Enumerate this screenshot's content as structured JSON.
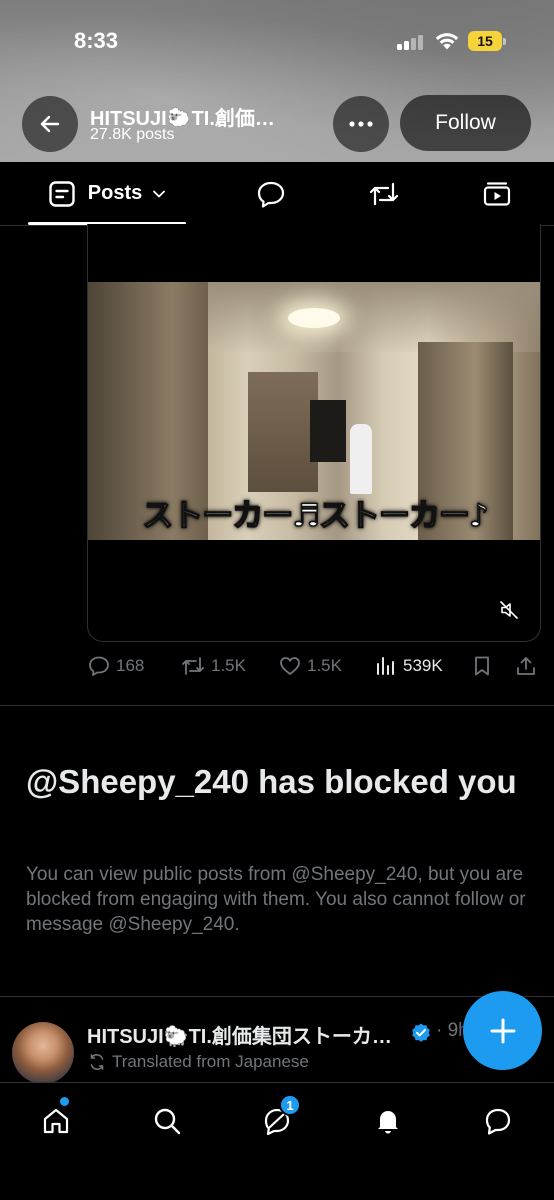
{
  "status_bar": {
    "time": "8:33",
    "battery_level": "15",
    "battery_color": "#f5d33a"
  },
  "header": {
    "profile_name": "HITSUJI🐑TI.創価…",
    "post_count": "27.8K posts",
    "follow_label": "Follow",
    "back_icon": "arrow-left-icon",
    "more_icon": "ellipsis-icon"
  },
  "tabs": {
    "posts_label": "Posts",
    "items": [
      "posts",
      "replies-icon",
      "reposts-icon",
      "media-icon"
    ]
  },
  "post": {
    "video_caption": "ストーカー♬ストーカー♪",
    "actions": {
      "replies": "168",
      "reposts": "1.5K",
      "likes": "1.5K",
      "views": "539K"
    }
  },
  "blocked_notice": {
    "title": "@Sheepy_240 has blocked you",
    "body": "You can view public posts from @Sheepy_240, but you are blocked from engaging with them. You also cannot follow or message @Sheepy_240."
  },
  "next_post": {
    "author": "HITSUJI🐑TI.創価集団ストーカ…",
    "time": "· 9h",
    "translated_label": "Translated from Japanese"
  },
  "bottom_nav": {
    "items": [
      "home-icon",
      "search-icon",
      "grok-icon",
      "notifications-icon",
      "messages-icon"
    ],
    "grok_badge": "1"
  },
  "colors": {
    "accent": "#1d9bf0",
    "muted": "#71767b",
    "divider": "#2f3336"
  }
}
